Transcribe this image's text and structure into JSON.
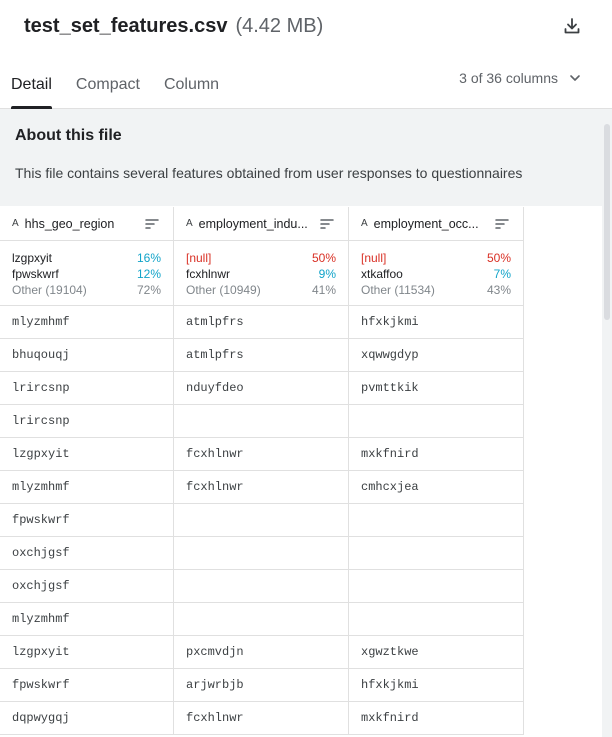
{
  "header": {
    "title": "test_set_features.csv",
    "size": "(4.42 MB)"
  },
  "tabs": [
    "Detail",
    "Compact",
    "Column"
  ],
  "column_selector": "3 of 36 columns",
  "about": {
    "title": "About this file",
    "description": "This file contains several features obtained from user responses to questionnaires"
  },
  "columns": [
    {
      "name": "hhs_geo_region",
      "summary": [
        {
          "label": "lzgpxyit",
          "pct": "16%",
          "kind": "value"
        },
        {
          "label": "fpwskwrf",
          "pct": "12%",
          "kind": "value"
        },
        {
          "label": "Other (19104)",
          "pct": "72%",
          "kind": "other"
        }
      ]
    },
    {
      "name": "employment_indu...",
      "summary": [
        {
          "label": "[null]",
          "pct": "50%",
          "kind": "null"
        },
        {
          "label": "fcxhlnwr",
          "pct": "9%",
          "kind": "value"
        },
        {
          "label": "Other (10949)",
          "pct": "41%",
          "kind": "other"
        }
      ]
    },
    {
      "name": "employment_occ...",
      "summary": [
        {
          "label": "[null]",
          "pct": "50%",
          "kind": "null"
        },
        {
          "label": "xtkaffoo",
          "pct": "7%",
          "kind": "value"
        },
        {
          "label": "Other (11534)",
          "pct": "43%",
          "kind": "other"
        }
      ]
    }
  ],
  "rows": [
    [
      "mlyzmhmf",
      "atmlpfrs",
      "hfxkjkmi"
    ],
    [
      "bhuqouqj",
      "atmlpfrs",
      "xqwwgdyp"
    ],
    [
      "lrircsnp",
      "nduyfdeo",
      "pvmttkik"
    ],
    [
      "lrircsnp",
      "",
      ""
    ],
    [
      "lzgpxyit",
      "fcxhlnwr",
      "mxkfnird"
    ],
    [
      "mlyzmhmf",
      "fcxhlnwr",
      "cmhcxjea"
    ],
    [
      "fpwskwrf",
      "",
      ""
    ],
    [
      "oxchjgsf",
      "",
      ""
    ],
    [
      "oxchjgsf",
      "",
      ""
    ],
    [
      "mlyzmhmf",
      "",
      ""
    ],
    [
      "lzgpxyit",
      "pxcmvdjn",
      "xgwztkwe"
    ],
    [
      "fpwskwrf",
      "arjwrbjb",
      "hfxkjkmi"
    ],
    [
      "dqpwygqj",
      "fcxhlnwr",
      "mxkfnird"
    ]
  ]
}
